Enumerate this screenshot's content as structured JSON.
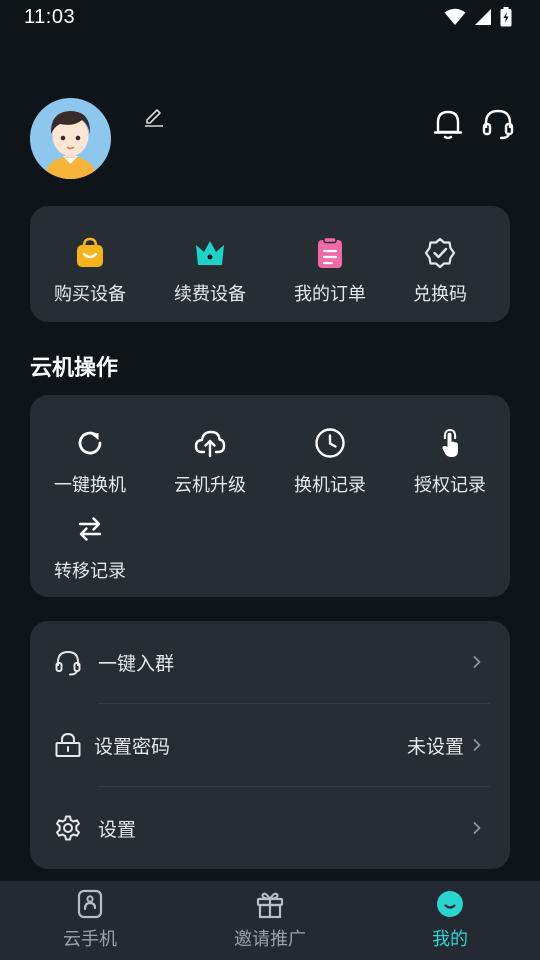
{
  "status": {
    "time": "11:03"
  },
  "quick_actions": [
    {
      "label": "购买设备",
      "icon": "shopping-bag-icon",
      "color": "#f5b31c"
    },
    {
      "label": "续费设备",
      "icon": "crown-icon",
      "color": "#1fd2c8"
    },
    {
      "label": "我的订单",
      "icon": "order-clipboard-icon",
      "color": "#f06aa8"
    },
    {
      "label": "兑换码",
      "icon": "badge-check-icon",
      "color": "#e6e8ea"
    }
  ],
  "operations": {
    "title": "云机操作",
    "items": [
      {
        "label": "一键换机",
        "icon": "refresh-icon"
      },
      {
        "label": "云机升级",
        "icon": "cloud-upload-icon"
      },
      {
        "label": "换机记录",
        "icon": "clock-icon"
      },
      {
        "label": "授权记录",
        "icon": "touch-hand-icon"
      },
      {
        "label": "转移记录",
        "icon": "swap-arrows-icon"
      }
    ]
  },
  "menu": [
    {
      "label": "一键入群",
      "icon": "headset-icon",
      "value": ""
    },
    {
      "label": "设置密码",
      "icon": "lock-icon",
      "value": "未设置"
    },
    {
      "label": "设置",
      "icon": "gear-icon",
      "value": ""
    }
  ],
  "tabs": [
    {
      "label": "云手机",
      "icon": "phone-cloud-icon",
      "active": false
    },
    {
      "label": "邀请推广",
      "icon": "gift-icon",
      "active": false
    },
    {
      "label": "我的",
      "icon": "face-icon",
      "active": true
    }
  ],
  "colors": {
    "accent": "#2ad4cf",
    "card": "#262d33",
    "background": "#0e1418"
  }
}
